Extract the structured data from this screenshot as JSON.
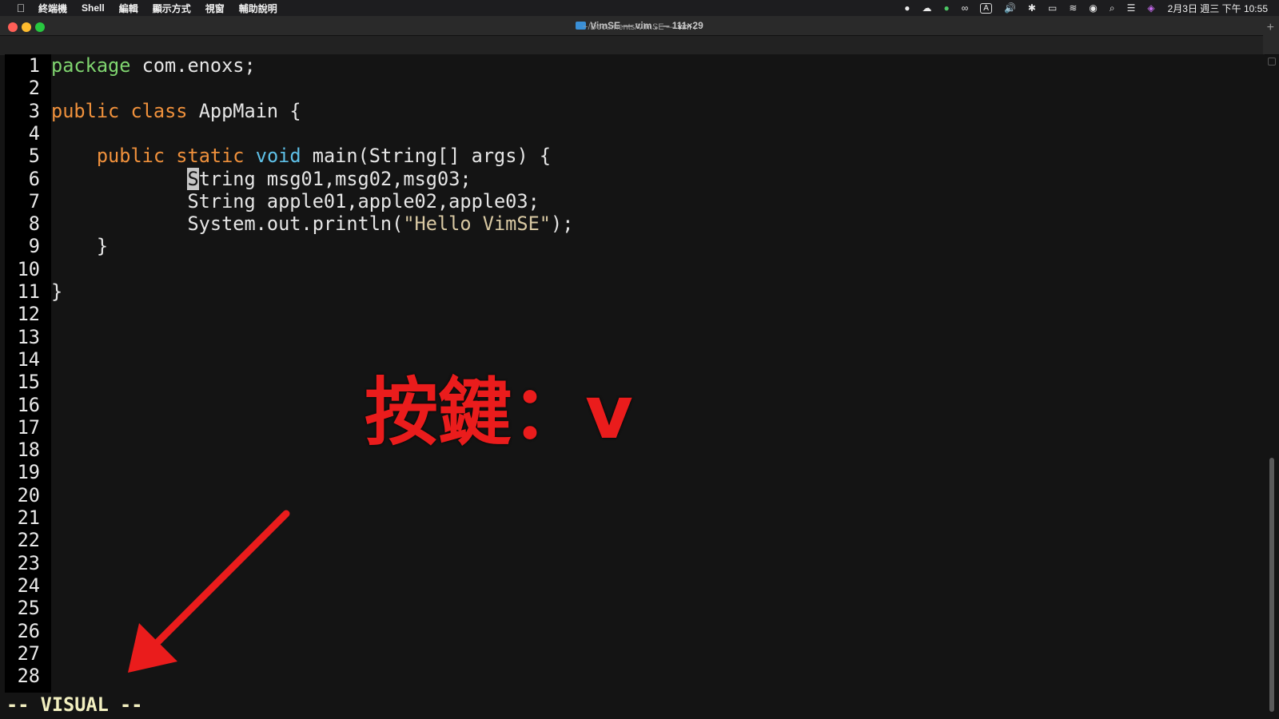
{
  "menubar": {
    "app_icon": "apple-icon",
    "items": [
      "終端機",
      "Shell",
      "編輯",
      "顯示方式",
      "視窗",
      "輔助說明"
    ],
    "tray": {
      "record": "●",
      "cloud": "☁",
      "line": "●",
      "glasses": "∞",
      "input": "A",
      "volume": "🔊",
      "bluetooth": "✱",
      "battery": "▭",
      "wifi": "≋",
      "user": "◉",
      "search": "⌕",
      "control": "☰",
      "siri": "◈"
    },
    "clock": "2月3日 週三 下午 10:55"
  },
  "window": {
    "title": "VimSE — vim . — 111×29",
    "tab_title_prefix": "~/Documents/VimSE — ",
    "tab_title_cmd": "vim .",
    "new_tab": "+"
  },
  "editor": {
    "line_numbers": [
      "1",
      "2",
      "3",
      "4",
      "5",
      "6",
      "7",
      "8",
      "9",
      "10",
      "11",
      "12",
      "13",
      "14",
      "15",
      "16",
      "17",
      "18",
      "19",
      "20",
      "21",
      "22",
      "23",
      "24",
      "25",
      "26",
      "27",
      "28"
    ],
    "line1": {
      "kw": "package",
      "rest": " com.enoxs;"
    },
    "line3": {
      "kw1": "public",
      "kw2": "class",
      "rest": " AppMain {"
    },
    "line5": {
      "indent": "    ",
      "kw1": "public",
      "kw2": "static",
      "kw3": "void",
      "rest": " main(String[] args) {"
    },
    "line6": {
      "indent": "            ",
      "cursor_char": "S",
      "rest": "tring msg01,msg02,msg03;"
    },
    "line7": {
      "text": "            String apple01,apple02,apple03;"
    },
    "line8": {
      "pre": "            System.out.println(",
      "str": "\"Hello VimSE\"",
      "post": ");"
    },
    "line9": {
      "text": "    }"
    },
    "line11": {
      "text": "}"
    },
    "mode": "-- VISUAL --"
  },
  "annotation": {
    "text": "按鍵：v",
    "color": "#ea1c1c"
  },
  "colors": {
    "keyword_green": "#7fd46f",
    "keyword_orange": "#f0913c",
    "keyword_blue": "#5fc1e8",
    "string": "#d9c9a3",
    "mode_text": "#f2efc0"
  }
}
